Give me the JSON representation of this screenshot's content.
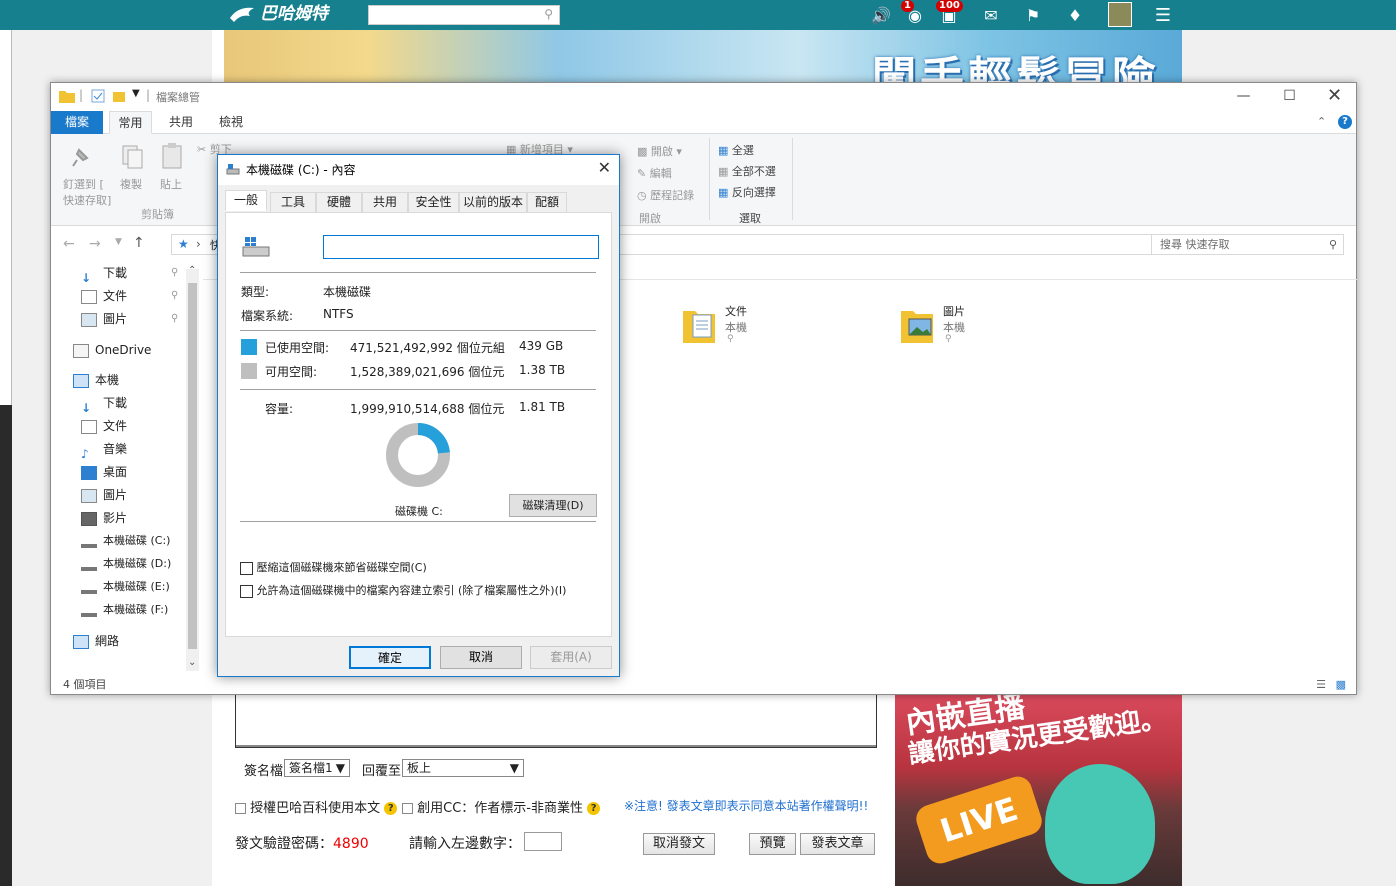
{
  "site": {
    "logo": "巴哈姆特",
    "search_placeholder": "",
    "badge_feed": "1",
    "badge_chat": "100"
  },
  "banner_text": "闖手輕鬆冒險",
  "post_form": {
    "signature_label": "簽名檔",
    "signature_value": "簽名檔1",
    "reply_label": "回覆至",
    "reply_value": "板上",
    "license1": "授權巴哈百科使用本文",
    "license2": "創用CC：作者標示-非商業性",
    "notice": "※注意! 發表文章即表示同意本站著作權聲明!!",
    "captcha_label": "發文驗證密碼：",
    "captcha_code": "4890",
    "captcha_prompt": "請輸入左邊數字：",
    "cancel_button": "取消發文",
    "preview_button": "預覽",
    "submit_button": "發表文章"
  },
  "ad": {
    "line1": "內嵌直播",
    "line2": "讓你的實況更受歡迎。",
    "live": "LIVE"
  },
  "explorer": {
    "title": "檔案總管",
    "tabs": [
      "檔案",
      "常用",
      "共用",
      "檢視"
    ],
    "ribbon": {
      "pin": "釘選到 [",
      "pin2": "快速存取]",
      "copy": "複製",
      "paste": "貼上",
      "cut": "剪下",
      "clipboard_group": "剪貼簿",
      "new_item": "新增項目",
      "open": "開啟",
      "edit": "編輯",
      "history": "歷程記錄",
      "open_group": "開啟",
      "select_all": "全選",
      "select_none": "全部不選",
      "invert": "反向選擇",
      "select_group": "選取"
    },
    "address": "快速存",
    "search_placeholder": "搜尋 快速存取",
    "nav": {
      "downloads": "下載",
      "documents": "文件",
      "pictures": "圖片",
      "onedrive": "OneDrive",
      "thispc": "本機",
      "pc_downloads": "下載",
      "pc_documents": "文件",
      "music": "音樂",
      "desktop": "桌面",
      "pc_pictures": "圖片",
      "videos": "影片",
      "drive_c": "本機磁碟 (C:)",
      "drive_d": "本機磁碟 (D:)",
      "drive_e": "本機磁碟 (E:)",
      "drive_f": "本機磁碟 (F:)",
      "network": "網路"
    },
    "items": [
      {
        "name": "文件",
        "location": "本機"
      },
      {
        "name": "圖片",
        "location": "本機"
      }
    ],
    "status": "4 個項目"
  },
  "dialog": {
    "title": "本機磁碟 (C:) - 內容",
    "tabs": [
      "一般",
      "工具",
      "硬體",
      "共用",
      "安全性",
      "以前的版本",
      "配額"
    ],
    "name_value": "",
    "type_label": "類型:",
    "type_value": "本機磁碟",
    "fs_label": "檔案系統:",
    "fs_value": "NTFS",
    "used_label": "已使用空間:",
    "used_bytes": "471,521,492,992 個位元組",
    "used_size": "439 GB",
    "free_label": "可用空間:",
    "free_bytes": "1,528,389,021,696 個位元",
    "free_size": "1.38 TB",
    "capacity_label": "容量:",
    "capacity_bytes": "1,999,910,514,688 個位元",
    "capacity_size": "1.81 TB",
    "used_fraction": 0.236,
    "drive_label": "磁碟機 C:",
    "cleanup_button": "磁碟清理(D)",
    "compress_label": "壓縮這個磁碟機來節省磁碟空間(C)",
    "index_label": "允許為這個磁碟機中的檔案內容建立索引 (除了檔案屬性之外)(I)",
    "ok": "確定",
    "cancel": "取消",
    "apply": "套用(A)",
    "used_color": "#26a0da",
    "free_color": "#bfbfbf"
  }
}
